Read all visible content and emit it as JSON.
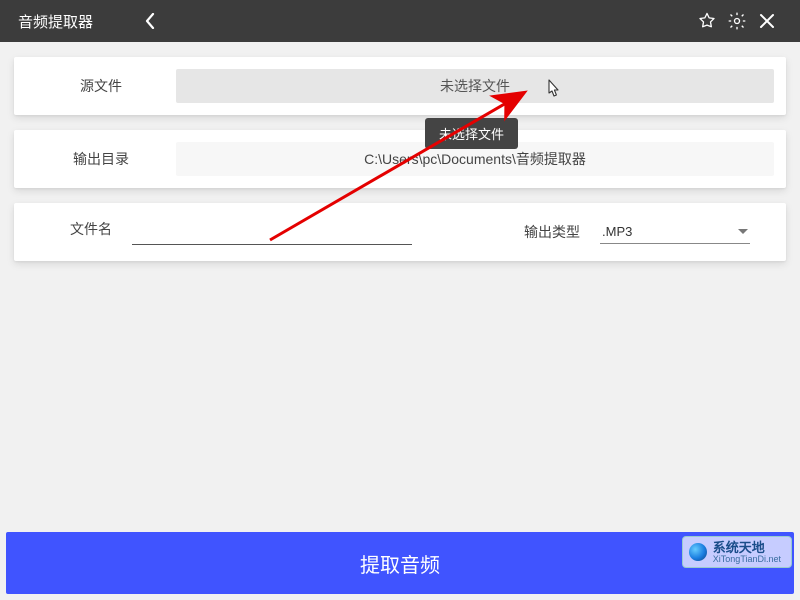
{
  "titlebar": {
    "title": "音频提取器"
  },
  "sourceFile": {
    "label": "源文件",
    "buttonText": "未选择文件",
    "tooltip": "未选择文件"
  },
  "outputDir": {
    "label": "输出目录",
    "path": "C:\\Users\\pc\\Documents\\音频提取器"
  },
  "filename": {
    "label": "文件名",
    "value": ""
  },
  "outputType": {
    "label": "输出类型",
    "selected": ".MP3"
  },
  "action": {
    "label": "提取音频"
  },
  "watermark": {
    "title": "系统天地",
    "sub": "XiTongTianDi.net"
  }
}
